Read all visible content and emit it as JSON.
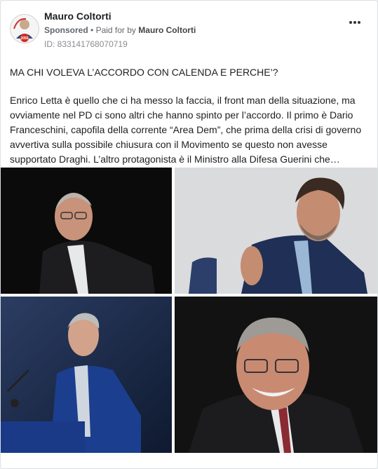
{
  "post": {
    "author": "Mauro Coltorti",
    "sponsored_label": "Sponsored",
    "paid_for_prefix": "Paid for by",
    "paid_by": "Mauro Coltorti",
    "ad_id": "ID: 833141768070719",
    "title": "MA CHI VOLEVA L’ACCORDO CON CALENDA E PERCHE’?",
    "body_lines": [
      "Enrico Letta è quello che ci ha messo la faccia, il front man della situazione, ma",
      "ovviamente nel PD ci sono altri che hanno spinto per l’accordo. Il primo è Dario",
      "Franceschini, capofila della corrente “Area Dem”, che prima della crisi di governo",
      "avvertiva sulla possibile chiusura con il Movimento se questo non avesse",
      "supportato Draghi. L’altro protagonista è il Ministro alla Difesa Guerini che…"
    ],
    "avatar_badge": "2050"
  },
  "icons": {
    "more": "more-options-icon",
    "separator": "•"
  },
  "colors": {
    "text": "#1c1e21",
    "secondary": "#65676b",
    "badge_red": "#d42a20"
  }
}
